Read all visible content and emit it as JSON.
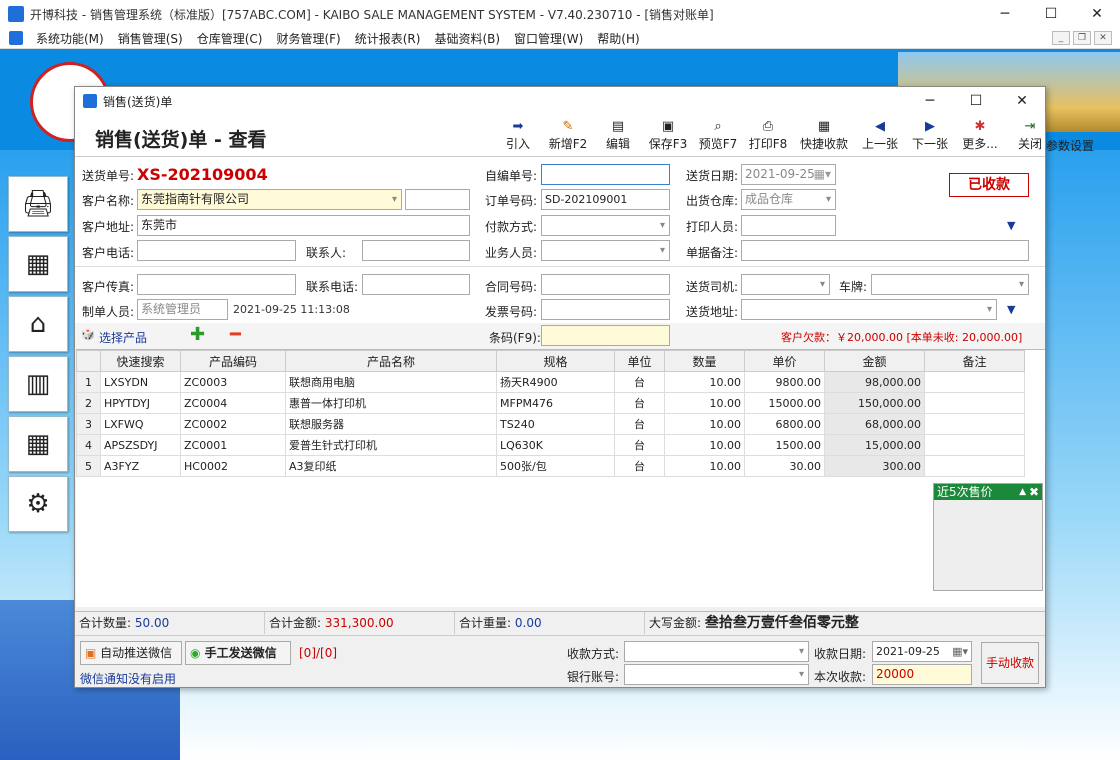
{
  "window": {
    "title": "开博科技 - 销售管理系统（标准版）[757ABC.COM] - KAIBO SALE MANAGEMENT SYSTEM - V7.40.230710 - [销售对账单]"
  },
  "menu": [
    "系统功能(M)",
    "销售管理(S)",
    "仓库管理(C)",
    "财务管理(F)",
    "统计报表(R)",
    "基础资料(B)",
    "窗口管理(W)",
    "帮助(H)"
  ],
  "bg": {
    "param_link": "参数设置"
  },
  "dialog": {
    "title": "销售(送货)单",
    "form_title": "销售(送货)单 - 查看"
  },
  "toolbar": [
    {
      "label": "引入",
      "icon": "import-icon"
    },
    {
      "label": "新增F2",
      "icon": "new-icon"
    },
    {
      "label": "编辑",
      "icon": "edit-icon"
    },
    {
      "label": "保存F3",
      "icon": "save-icon"
    },
    {
      "label": "预览F7",
      "icon": "preview-icon"
    },
    {
      "label": "打印F8",
      "icon": "print-icon"
    },
    {
      "label": "快捷收款",
      "icon": "quick-receipt-icon"
    },
    {
      "label": "上一张",
      "icon": "prev-icon"
    },
    {
      "label": "下一张",
      "icon": "next-icon"
    },
    {
      "label": "更多...",
      "icon": "more-icon"
    },
    {
      "label": "关闭",
      "icon": "close-icon"
    }
  ],
  "form": {
    "bill_no_label": "送货单号:",
    "bill_no": "XS-202109004",
    "self_no_label": "自编单号:",
    "self_no": "",
    "date_label": "送货日期:",
    "date": "2021-09-25",
    "status": "已收款",
    "customer_label": "客户名称:",
    "customer": "东莞指南针有限公司",
    "order_no_label": "订单号码:",
    "order_no": "SD-202109001",
    "warehouse_label": "出货仓库:",
    "warehouse": "成品仓库",
    "address_label": "客户地址:",
    "address": "东莞市",
    "pay_method_label": "付款方式:",
    "pay_method": "",
    "printer_label": "打印人员:",
    "printer": "",
    "phone_label": "客户电话:",
    "phone": "",
    "contact_label": "联系人:",
    "contact": "",
    "salesman_label": "业务人员:",
    "salesman": "",
    "remark_label": "单据备注:",
    "remark": "",
    "fax_label": "客户传真:",
    "fax": "",
    "contact_phone_label": "联系电话:",
    "contact_phone": "",
    "contract_label": "合同号码:",
    "contract": "",
    "driver_label": "送货司机:",
    "driver": "",
    "plate_label": "车牌:",
    "plate": "",
    "maker_label": "制单人员:",
    "maker": "系统管理员",
    "made_time": "2021-09-25 11:13:08",
    "invoice_label": "发票号码:",
    "invoice": "",
    "ship_addr_label": "送货地址:",
    "ship_addr": ""
  },
  "products": {
    "select_label": "选择产品",
    "barcode_label": "条码(F9):",
    "barcode": "",
    "arrears": "客户欠款：￥20,000.00 [本单未收: 20,000.00]"
  },
  "table": {
    "headers": [
      "快速搜索",
      "产品编码",
      "产品名称",
      "规格",
      "单位",
      "数量",
      "单价",
      "金额",
      "备注"
    ],
    "rows": [
      [
        "1",
        "LXSYDN",
        "ZC0003",
        "联想商用电脑",
        "扬天R4900",
        "台",
        "10.00",
        "9800.00",
        "98,000.00",
        ""
      ],
      [
        "2",
        "HPYTDYJ",
        "ZC0004",
        "惠普一体打印机",
        "MFPM476",
        "台",
        "10.00",
        "15000.00",
        "150,000.00",
        ""
      ],
      [
        "3",
        "LXFWQ",
        "ZC0002",
        "联想服务器",
        "TS240",
        "台",
        "10.00",
        "6800.00",
        "68,000.00",
        ""
      ],
      [
        "4",
        "APSZSDYJ",
        "ZC0001",
        "爱普生针式打印机",
        "LQ630K",
        "台",
        "10.00",
        "1500.00",
        "15,000.00",
        ""
      ],
      [
        "5",
        "A3FYZ",
        "HC0002",
        "A3复印纸",
        "500张/包",
        "台",
        "10.00",
        "30.00",
        "300.00",
        ""
      ]
    ]
  },
  "recent": {
    "title": "近5次售价"
  },
  "totals": {
    "qty_label": "合计数量:",
    "qty": "50.00",
    "amount_label": "合计金额:",
    "amount": "331,300.00",
    "weight_label": "合计重量:",
    "weight": "0.00",
    "upper_label": "大写金额:",
    "upper": "叁拾叁万壹仟叁佰零元整"
  },
  "footer": {
    "auto_wechat": "自动推送微信",
    "manual_wechat": "手工发送微信",
    "count": "[0]/[0]",
    "notice": "微信通知没有启用",
    "pay_method_label": "收款方式:",
    "pay_method": "",
    "recv_date_label": "收款日期:",
    "recv_date": "2021-09-25",
    "bank_label": "银行账号:",
    "bank": "",
    "this_recv_label": "本次收款:",
    "this_recv": "20000",
    "manual_recv": "手动收款"
  }
}
